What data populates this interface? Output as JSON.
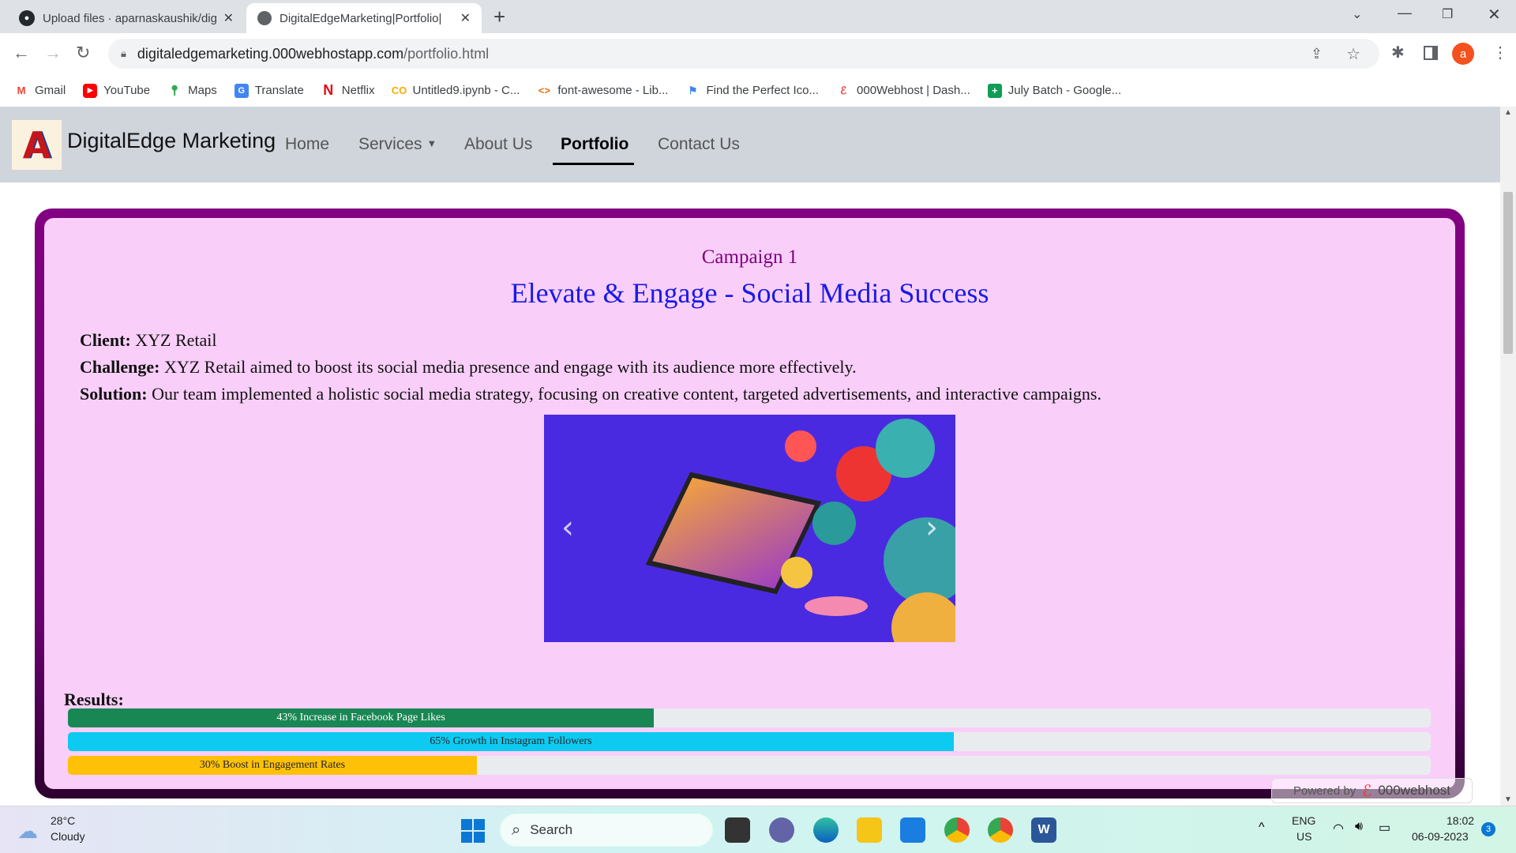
{
  "browser": {
    "tabs": [
      {
        "title": "Upload files · aparnaskaushik/dig",
        "icon": "github-icon"
      },
      {
        "title": "DigitalEdgeMarketing|Portfolio|",
        "icon": "globe-icon"
      }
    ],
    "url_domain": "digitaledgemarketing.000webhostapp.com",
    "url_path": "/portfolio.html",
    "profile_initial": "a",
    "bookmarks": [
      "Gmail",
      "YouTube",
      "Maps",
      "Translate",
      "Netflix",
      "Untitled9.ipynb - C...",
      "font-awesome - Lib...",
      "Find the Perfect Ico...",
      "000Webhost | Dash...",
      "July Batch - Google..."
    ]
  },
  "navbar": {
    "brand": "DigitalEdge Marketing",
    "logo_letter": "A",
    "items": [
      "Home",
      "Services",
      "About Us",
      "Portfolio",
      "Contact Us"
    ],
    "active": "Portfolio"
  },
  "campaign": {
    "label": "Campaign 1",
    "title": "Elevate & Engage - Social Media Success",
    "client_label": "Client:",
    "client": "XYZ Retail",
    "challenge_label": "Challenge:",
    "challenge": "XYZ Retail aimed to boost its social media presence and engage with its audience more effectively.",
    "solution_label": "Solution:",
    "solution": "Our team implemented a holistic social media strategy, focusing on creative content, targeted advertisements, and interactive campaigns.",
    "results_label": "Results:",
    "results": [
      {
        "label": "43% Increase in Facebook Page Likes",
        "percent": 43,
        "color": "#198754",
        "text_color": "#ffffff"
      },
      {
        "label": "65% Growth in Instagram Followers",
        "percent": 65,
        "color": "#0dcaf0",
        "text_color": "#212529"
      },
      {
        "label": "30% Boost in Engagement Rates",
        "percent": 30,
        "color": "#ffc107",
        "text_color": "#212529"
      }
    ]
  },
  "powered_by": {
    "prefix": "Powered by",
    "brand": "000webhost"
  },
  "taskbar": {
    "weather_temp": "28°C",
    "weather_desc": "Cloudy",
    "search_placeholder": "Search",
    "lang": "ENG",
    "region": "US",
    "time": "18:02",
    "date": "06-09-2023",
    "notifications": "3"
  }
}
